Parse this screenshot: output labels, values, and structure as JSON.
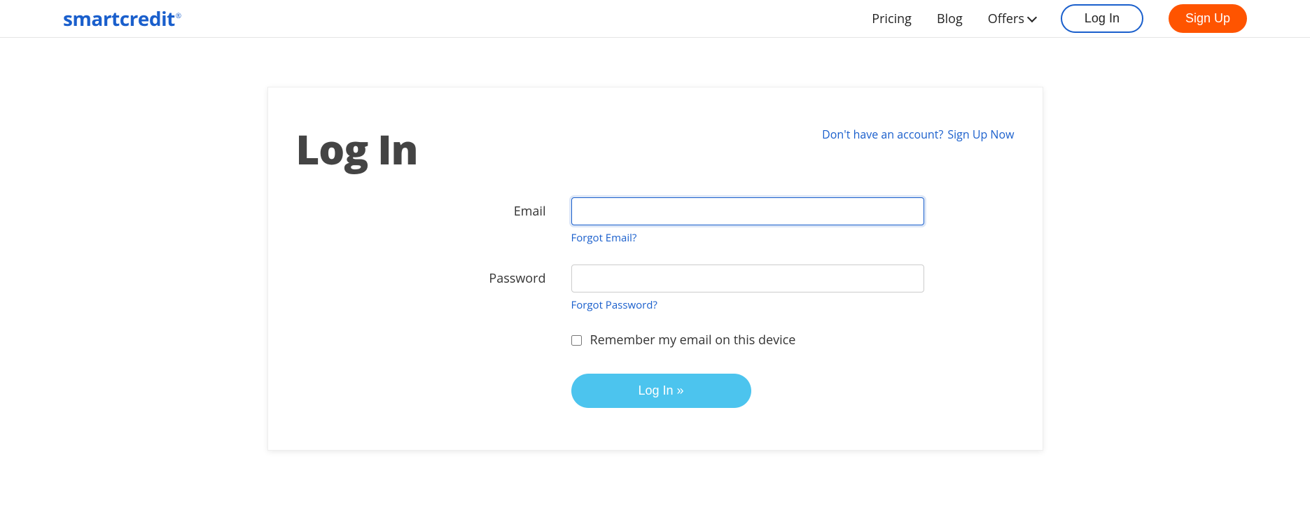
{
  "brand": {
    "name": "smartcredit",
    "reg": "®"
  },
  "nav": {
    "pricing": "Pricing",
    "blog": "Blog",
    "offers": "Offers",
    "login": "Log In",
    "signup": "Sign Up"
  },
  "page": {
    "title": "Log In",
    "signup_prompt_text": "Don't have an account?",
    "signup_prompt_link": "Sign Up Now"
  },
  "form": {
    "email_label": "Email",
    "email_value": "",
    "forgot_email": "Forgot Email?",
    "password_label": "Password",
    "password_value": "",
    "forgot_password": "Forgot Password?",
    "remember_label": "Remember my email on this device",
    "submit_label": "Log In »"
  }
}
